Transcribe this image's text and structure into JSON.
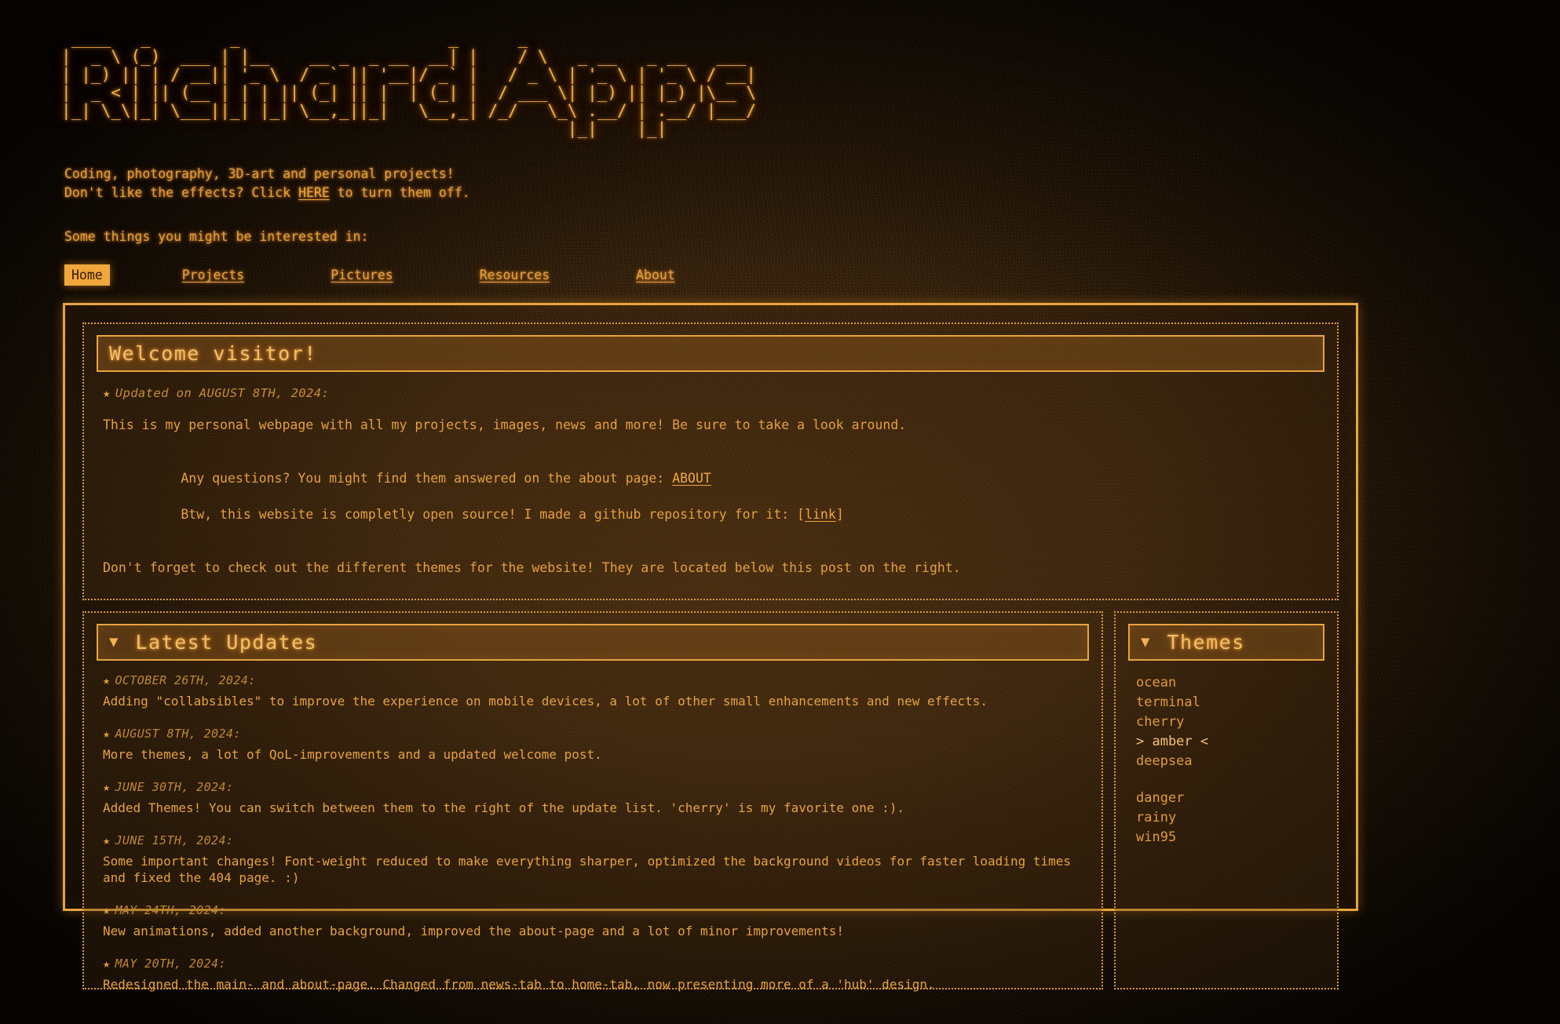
{
  "site": {
    "logo_alt": "RichardApps",
    "logo_ascii": " ____   _        _                     _      _                     \n|  _ \\ (_)  ___ | |__    __ _  _ __  __| |    / \\   _ __   _ __   ___ \n| |_) || | / __|| '_ \\  / _` || '__|/ _` |   / _ \\ | '_ \\ | '_ \\ / __|\n|  _ < | || (__ | | | || (_| || |  | (_| |  / ___ \\| |_) || |_) |\\__ \\\n|_| \\_\\|_| \\___||_| |_| \\__,_||_|   \\__,_| /_/   \\_\\ .__/ | .__/ |___/\n                                                   |_|    |_|         ",
    "accent_color": "#e9a43f",
    "background_color": "#140d06",
    "text_color": "#e8a13c"
  },
  "intro": {
    "line1": "Coding, photography, 3D-art and personal projects!",
    "line2_before": "Don't like the effects? Click ",
    "line2_link": "HERE",
    "line2_after": " to turn them off.",
    "interest_line": "Some things you might be interested in:"
  },
  "nav": {
    "items": [
      {
        "label": "Home",
        "active": true
      },
      {
        "label": "Projects",
        "active": false
      },
      {
        "label": "Pictures",
        "active": false
      },
      {
        "label": "Resources",
        "active": false
      },
      {
        "label": "About",
        "active": false
      }
    ]
  },
  "welcome": {
    "title": "Welcome visitor!",
    "star": "★",
    "updated_label": "Updated on AUGUST 8TH, 2024:",
    "para1": "This is my personal webpage with all my projects, images, news and more! Be sure to take a look around.",
    "para2_before": "Any questions? You might find them answered on the about page: ",
    "para2_link": "ABOUT",
    "para3_before": "Btw, this website is completly open source! I made a github repository for it: [",
    "para3_link": "link",
    "para3_after": "]",
    "para4": "Don't forget to check out the different themes for the website! They are located below this post on the right."
  },
  "updates": {
    "caret": "▼",
    "title": "Latest Updates",
    "star": "★",
    "items": [
      {
        "date": "OCTOBER 26TH, 2024:",
        "text": "Adding \"collabsibles\" to improve the experience on mobile devices, a lot of other small enhancements and new effects."
      },
      {
        "date": "AUGUST 8TH, 2024:",
        "text": "More themes, a lot of QoL-improvements and a updated welcome post."
      },
      {
        "date": "JUNE 30TH, 2024:",
        "text": "Added Themes! You can switch between them to the right of the update list. 'cherry' is my favorite one :)."
      },
      {
        "date": "JUNE 15TH, 2024:",
        "text": "Some important changes! Font-weight reduced to make everything sharper, optimized the background videos for faster loading times and fixed the 404 page. :)"
      },
      {
        "date": "MAY 24TH, 2024:",
        "text": "New animations, added another background, improved the about-page and a lot of minor improvements!"
      },
      {
        "date": "MAY 20TH, 2024:",
        "text": "Redesigned the main- and about-page. Changed from news-tab to home-tab, now presenting more of a 'hub' design."
      }
    ]
  },
  "themes": {
    "caret": "▼",
    "title": "Themes",
    "selected": "amber",
    "group1": [
      {
        "label": "ocean",
        "selected": false
      },
      {
        "label": "terminal",
        "selected": false
      },
      {
        "label": "cherry",
        "selected": false
      },
      {
        "label": "> amber <",
        "selected": true
      },
      {
        "label": "deepsea",
        "selected": false
      }
    ],
    "group2": [
      {
        "label": "danger",
        "selected": false
      },
      {
        "label": "rainy",
        "selected": false
      },
      {
        "label": "win95",
        "selected": false
      }
    ]
  }
}
